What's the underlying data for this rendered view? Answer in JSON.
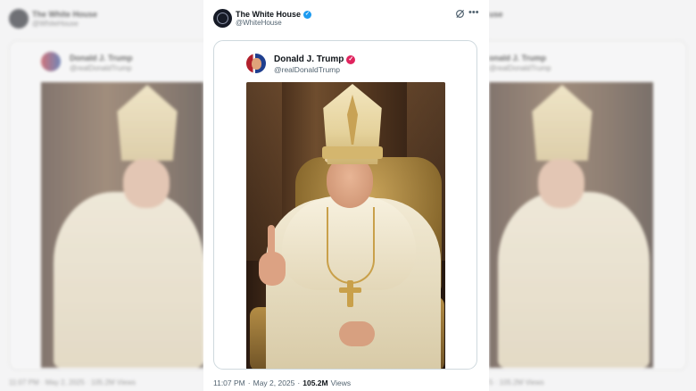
{
  "post": {
    "author": {
      "name": "The White House",
      "handle": "@WhiteHouse",
      "verified": true,
      "badge_color": "#1d9bf0"
    },
    "quoted_post": {
      "author": {
        "name": "Donald J. Trump",
        "handle": "@realDonaldTrump",
        "verified": true,
        "badge_color": "#e0245e"
      },
      "image_description_icon": "photo"
    },
    "meta": {
      "time": "11:07 PM",
      "separator": "·",
      "date": "May 2, 2025",
      "views_count": "105.2M",
      "views_label": "Views"
    }
  },
  "background": {
    "left": {
      "author_name": "The White House",
      "author_handle": "@WhiteHouse",
      "quoted_name": "Donald J. Trump",
      "quoted_handle": "@realDonaldTrump",
      "meta": "11:07 PM · May 2, 2025 · 105.2M Views"
    },
    "right": {
      "author_name": "use",
      "quoted_name": "onald J. Trump",
      "quoted_handle": "@realDonaldTrump",
      "meta": "5 · 105.2M Views"
    }
  },
  "icons": {
    "verified": "check-badge-icon",
    "grok": "grok-icon",
    "more": "more-icon"
  }
}
